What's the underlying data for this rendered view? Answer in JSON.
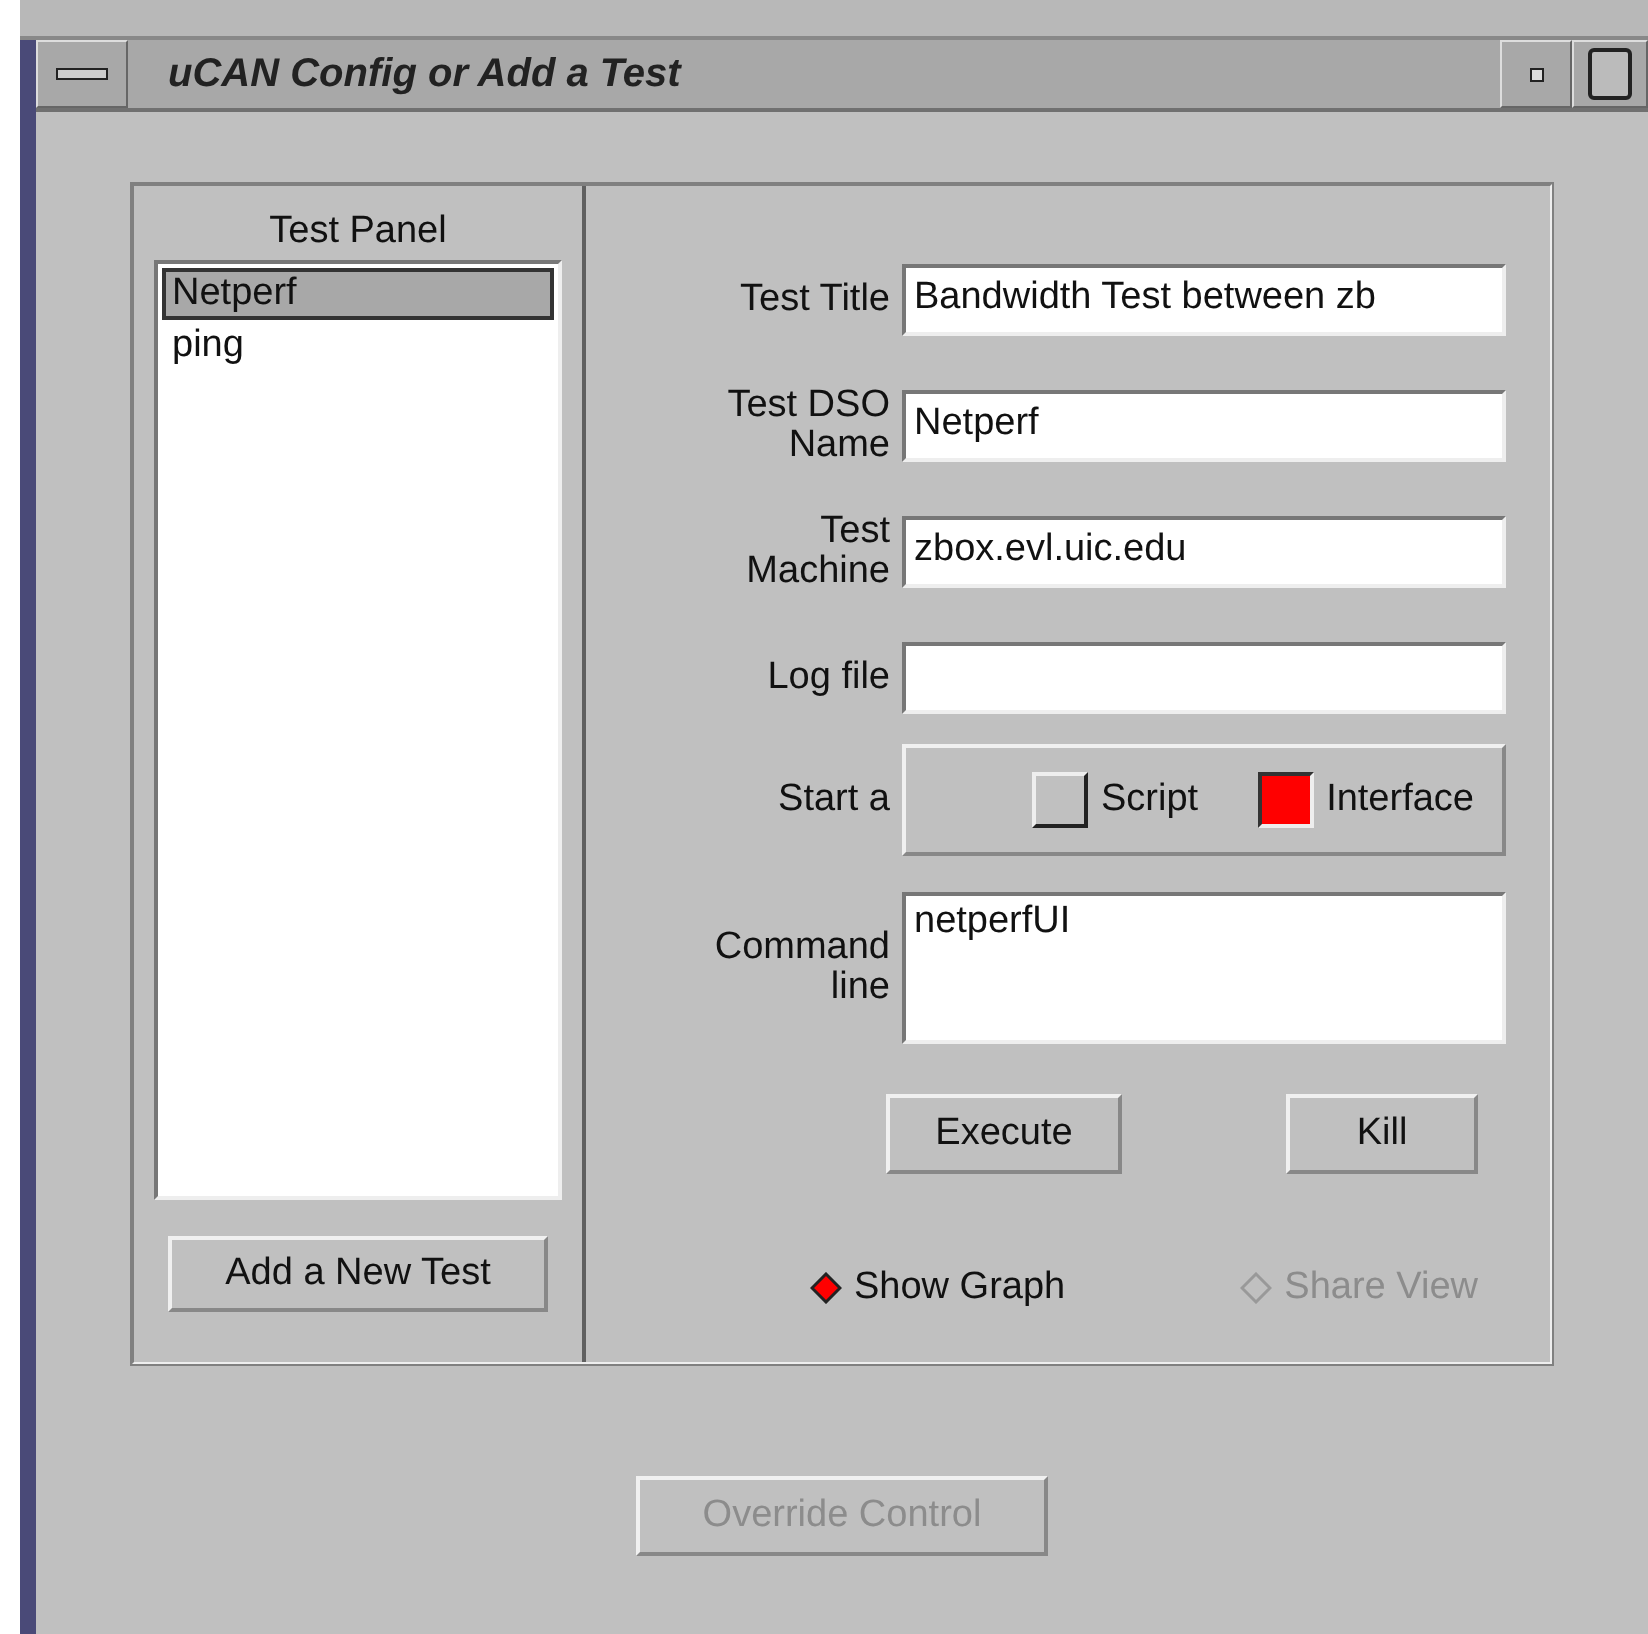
{
  "window": {
    "title": "uCAN Config or Add a Test"
  },
  "test_panel": {
    "title": "Test Panel",
    "items": [
      {
        "label": "Netperf",
        "selected": true
      },
      {
        "label": "ping",
        "selected": false
      }
    ],
    "add_button": "Add a New Test"
  },
  "fields": [
    {
      "label": "Test Title",
      "value": "Bandwidth Test between zb"
    },
    {
      "label": "Test DSO Name",
      "value": "Netperf"
    },
    {
      "label": "Test Machine",
      "value": "zbox.evl.uic.edu"
    },
    {
      "label": "Log file"
    }
  ],
  "start": {
    "label": "Start a",
    "options": [
      {
        "label": "Script",
        "selected": false
      },
      {
        "label": "Interface",
        "selected": true
      }
    ]
  },
  "command_line": {
    "label": "Command line",
    "value": "netperfUI"
  },
  "buttons": [
    {
      "label": "Execute"
    },
    {
      "label": "Kill"
    }
  ],
  "toggles": [
    {
      "label": "Show Graph",
      "selected": true,
      "disabled": false
    },
    {
      "label": "Share View",
      "selected": false,
      "disabled": true
    }
  ],
  "override_button": {
    "label": "Override Control",
    "disabled": true
  }
}
